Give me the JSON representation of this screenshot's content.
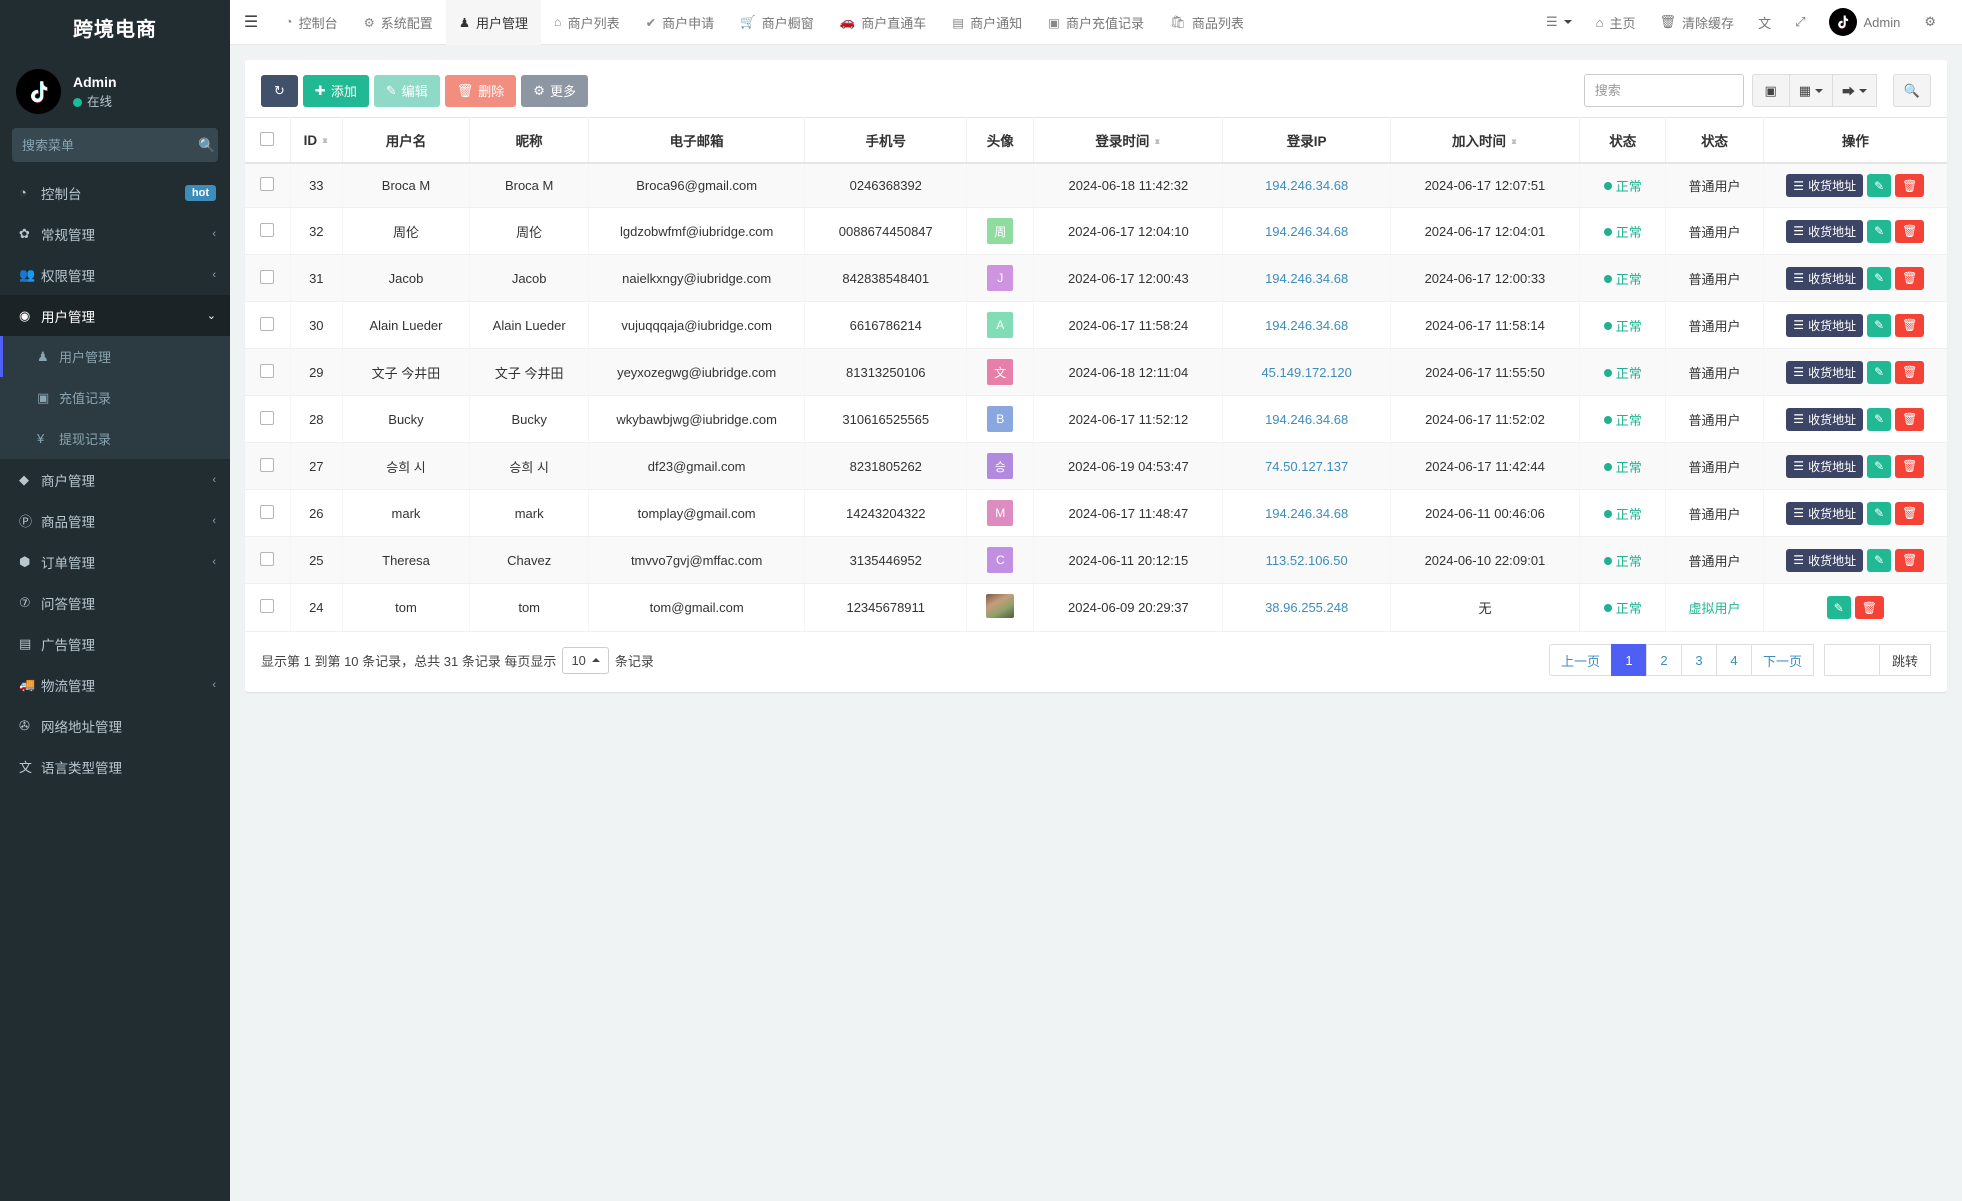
{
  "sidebar": {
    "brand": "跨境电商",
    "user": {
      "name": "Admin",
      "status": "在线"
    },
    "search_placeholder": "搜索菜单",
    "items": [
      {
        "label": "控制台",
        "icon": "dashboard-icon",
        "glyph": "◔",
        "badge": "hot",
        "chevron": ""
      },
      {
        "label": "常规管理",
        "icon": "cogs-icon",
        "glyph": "✿",
        "badge": "",
        "chevron": "‹"
      },
      {
        "label": "权限管理",
        "icon": "users-icon",
        "glyph": "👥",
        "badge": "",
        "chevron": "‹"
      },
      {
        "label": "用户管理",
        "icon": "user-circle-icon",
        "glyph": "◉",
        "badge": "",
        "chevron": "⌄",
        "state": "open"
      },
      {
        "label": "用户管理",
        "icon": "user-icon",
        "glyph": "♟",
        "badge": "",
        "chevron": "",
        "state": "active-sub"
      },
      {
        "label": "充值记录",
        "icon": "money-icon",
        "glyph": "▣",
        "badge": "",
        "chevron": "",
        "state": "sub"
      },
      {
        "label": "提现记录",
        "icon": "yen-icon",
        "glyph": "¥",
        "badge": "",
        "chevron": "",
        "state": "sub"
      },
      {
        "label": "商户管理",
        "icon": "apple-icon",
        "glyph": "",
        "badge": "",
        "chevron": "‹"
      },
      {
        "label": "商品管理",
        "icon": "product-icon",
        "glyph": "Ⓟ",
        "badge": "",
        "chevron": "‹"
      },
      {
        "label": "订单管理",
        "icon": "order-icon",
        "glyph": "⬢",
        "badge": "",
        "chevron": "‹"
      },
      {
        "label": "问答管理",
        "icon": "question-icon",
        "glyph": "⑦",
        "badge": "",
        "chevron": ""
      },
      {
        "label": "广告管理",
        "icon": "ad-icon",
        "glyph": "▤",
        "badge": "",
        "chevron": ""
      },
      {
        "label": "物流管理",
        "icon": "truck-icon",
        "glyph": "🚚",
        "badge": "",
        "chevron": "‹"
      },
      {
        "label": "网络地址管理",
        "icon": "link-icon",
        "glyph": "✇",
        "badge": "",
        "chevron": ""
      },
      {
        "label": "语言类型管理",
        "icon": "language-icon",
        "glyph": "文",
        "badge": "",
        "chevron": ""
      }
    ]
  },
  "topbar": {
    "menu_toggle_icon": "hamburger-icon",
    "nav": [
      {
        "label": "控制台",
        "icon": "dashboard-icon",
        "glyph": "◔",
        "active": false
      },
      {
        "label": "系统配置",
        "icon": "gear-icon",
        "glyph": "⚙",
        "active": false
      },
      {
        "label": "用户管理",
        "icon": "user-icon",
        "glyph": "♟",
        "active": true
      },
      {
        "label": "商户列表",
        "icon": "home-icon",
        "glyph": "⌂",
        "active": false
      },
      {
        "label": "商户申请",
        "icon": "check-circle-icon",
        "glyph": "✔",
        "active": false
      },
      {
        "label": "商户橱窗",
        "icon": "cart-icon",
        "glyph": "🛒",
        "active": false
      },
      {
        "label": "商户直通车",
        "icon": "car-icon",
        "glyph": "🚗",
        "active": false
      },
      {
        "label": "商户通知",
        "icon": "bell-note-icon",
        "glyph": "▤",
        "active": false
      },
      {
        "label": "商户充值记录",
        "icon": "money-icon",
        "glyph": "▣",
        "active": false
      },
      {
        "label": "商品列表",
        "icon": "bag-icon",
        "glyph": "🛍",
        "active": false
      }
    ],
    "right": {
      "list_menu": {
        "label": "",
        "icon": "list-menu-icon",
        "glyph": "☰"
      },
      "home": {
        "label": "主页",
        "icon": "home-icon",
        "glyph": "⌂"
      },
      "clear_cache": {
        "label": "清除缓存",
        "icon": "trash-icon",
        "glyph": "🗑"
      },
      "language": {
        "label": "",
        "icon": "language-icon",
        "glyph": "文"
      },
      "fullscreen": {
        "label": "",
        "icon": "fullscreen-icon",
        "glyph": "⤢"
      },
      "account": {
        "label": "Admin",
        "icon": "tiktok-avatar"
      },
      "settings": {
        "label": "",
        "icon": "gear-icon",
        "glyph": "⚙"
      }
    }
  },
  "toolbar": {
    "refresh_label": "",
    "add_label": "添加",
    "edit_label": "编辑",
    "delete_label": "删除",
    "more_label": "更多",
    "search_placeholder": "搜索",
    "search_value": "",
    "icons": {
      "refresh": "refresh-icon",
      "add": "plus-icon",
      "edit": "pencil-icon",
      "delete": "trash-icon",
      "more": "gear-icon",
      "list_view": "list-view-icon",
      "columns": "columns-grid-icon",
      "export": "export-icon",
      "search": "search-icon"
    }
  },
  "table": {
    "columns": [
      {
        "key": "check",
        "label": "",
        "sortable": false
      },
      {
        "key": "id",
        "label": "ID",
        "sortable": true
      },
      {
        "key": "username",
        "label": "用户名",
        "sortable": false
      },
      {
        "key": "nickname",
        "label": "昵称",
        "sortable": false
      },
      {
        "key": "email",
        "label": "电子邮箱",
        "sortable": false
      },
      {
        "key": "phone",
        "label": "手机号",
        "sortable": false
      },
      {
        "key": "avatar",
        "label": "头像",
        "sortable": false
      },
      {
        "key": "login_time",
        "label": "登录时间",
        "sortable": true
      },
      {
        "key": "login_ip",
        "label": "登录IP",
        "sortable": false
      },
      {
        "key": "join_time",
        "label": "加入时间",
        "sortable": true
      },
      {
        "key": "status",
        "label": "状态",
        "sortable": false
      },
      {
        "key": "user_type",
        "label": "状态",
        "sortable": false
      },
      {
        "key": "actions",
        "label": "操作",
        "sortable": false
      }
    ],
    "rows": [
      {
        "id": "33",
        "username": "Broca M",
        "nickname": "Broca M",
        "email": "Broca96@gmail.com",
        "phone": "0246368392",
        "avatar_letter": "",
        "avatar_color": "",
        "avatar_kind": "none",
        "login_time": "2024-06-18 11:42:32",
        "login_ip": "194.246.34.68",
        "join_time": "2024-06-17 12:07:51",
        "status": "正常",
        "user_type": "普通用户",
        "actions": [
          "收货地址",
          "edit",
          "delete"
        ]
      },
      {
        "id": "32",
        "username": "周伦",
        "nickname": "周伦",
        "email": "lgdzobwfmf@iubridge.com",
        "phone": "0088674450847",
        "avatar_letter": "周",
        "avatar_color": "#8fdba0",
        "avatar_kind": "letter",
        "login_time": "2024-06-17 12:04:10",
        "login_ip": "194.246.34.68",
        "join_time": "2024-06-17 12:04:01",
        "status": "正常",
        "user_type": "普通用户",
        "actions": [
          "收货地址",
          "edit",
          "delete"
        ]
      },
      {
        "id": "31",
        "username": "Jacob",
        "nickname": "Jacob",
        "email": "naielkxngy@iubridge.com",
        "phone": "842838548401",
        "avatar_letter": "J",
        "avatar_color": "#cf94e0",
        "avatar_kind": "letter",
        "login_time": "2024-06-17 12:00:43",
        "login_ip": "194.246.34.68",
        "join_time": "2024-06-17 12:00:33",
        "status": "正常",
        "user_type": "普通用户",
        "actions": [
          "收货地址",
          "edit",
          "delete"
        ]
      },
      {
        "id": "30",
        "username": "Alain Lueder",
        "nickname": "Alain Lueder",
        "email": "vujuqqqaja@iubridge.com",
        "phone": "6616786214",
        "avatar_letter": "A",
        "avatar_color": "#81ddb5",
        "avatar_kind": "letter",
        "login_time": "2024-06-17 11:58:24",
        "login_ip": "194.246.34.68",
        "join_time": "2024-06-17 11:58:14",
        "status": "正常",
        "user_type": "普通用户",
        "actions": [
          "收货地址",
          "edit",
          "delete"
        ]
      },
      {
        "id": "29",
        "username": "文子 今井田",
        "nickname": "文子 今井田",
        "email": "yeyxozegwg@iubridge.com",
        "phone": "81313250106",
        "avatar_letter": "文",
        "avatar_color": "#e87fa8",
        "avatar_kind": "letter",
        "login_time": "2024-06-18 12:11:04",
        "login_ip": "45.149.172.120",
        "join_time": "2024-06-17 11:55:50",
        "status": "正常",
        "user_type": "普通用户",
        "actions": [
          "收货地址",
          "edit",
          "delete"
        ]
      },
      {
        "id": "28",
        "username": "Bucky",
        "nickname": "Bucky",
        "email": "wkybawbjwg@iubridge.com",
        "phone": "310616525565",
        "avatar_letter": "B",
        "avatar_color": "#8aa7e0",
        "avatar_kind": "letter",
        "login_time": "2024-06-17 11:52:12",
        "login_ip": "194.246.34.68",
        "join_time": "2024-06-17 11:52:02",
        "status": "正常",
        "user_type": "普通用户",
        "actions": [
          "收货地址",
          "edit",
          "delete"
        ]
      },
      {
        "id": "27",
        "username": "승희 시",
        "nickname": "승희 시",
        "email": "df23@gmail.com",
        "phone": "8231805262",
        "avatar_letter": "승",
        "avatar_color": "#b18ae0",
        "avatar_kind": "letter",
        "login_time": "2024-06-19 04:53:47",
        "login_ip": "74.50.127.137",
        "join_time": "2024-06-17 11:42:44",
        "status": "正常",
        "user_type": "普通用户",
        "actions": [
          "收货地址",
          "edit",
          "delete"
        ]
      },
      {
        "id": "26",
        "username": "mark",
        "nickname": "mark",
        "email": "tomplay@gmail.com",
        "phone": "14243204322",
        "avatar_letter": "M",
        "avatar_color": "#dd8cc0",
        "avatar_kind": "letter",
        "login_time": "2024-06-17 11:48:47",
        "login_ip": "194.246.34.68",
        "join_time": "2024-06-11 00:46:06",
        "status": "正常",
        "user_type": "普通用户",
        "actions": [
          "收货地址",
          "edit",
          "delete"
        ]
      },
      {
        "id": "25",
        "username": "Theresa",
        "nickname": "Chavez",
        "email": "tmvvo7gvj@mffac.com",
        "phone": "3135446952",
        "avatar_letter": "C",
        "avatar_color": "#c190e3",
        "avatar_kind": "letter",
        "login_time": "2024-06-11 20:12:15",
        "login_ip": "113.52.106.50",
        "join_time": "2024-06-10 22:09:01",
        "status": "正常",
        "user_type": "普通用户",
        "actions": [
          "收货地址",
          "edit",
          "delete"
        ]
      },
      {
        "id": "24",
        "username": "tom",
        "nickname": "tom",
        "email": "tom@gmail.com",
        "phone": "12345678911",
        "avatar_letter": "",
        "avatar_color": "",
        "avatar_kind": "photo",
        "login_time": "2024-06-09 20:29:37",
        "login_ip": "38.96.255.248",
        "join_time": "无",
        "status": "正常",
        "user_type": "虚拟用户",
        "actions": [
          "edit",
          "delete"
        ]
      }
    ]
  },
  "footer": {
    "summary_prefix": "显示第 1 到第 10 条记录，总共 31 条记录 每页显示",
    "page_size": "10",
    "summary_suffix": "条记录",
    "prev_label": "上一页",
    "pages": [
      "1",
      "2",
      "3",
      "4"
    ],
    "current_page": "1",
    "next_label": "下一页",
    "jump_value": "",
    "jump_label": "跳转"
  },
  "colors": {
    "accent_blue": "#4f5ff5",
    "teal": "#21b894",
    "danger": "#f44336",
    "navy": "#3d4566",
    "sidebar_bg": "#222d32",
    "link": "#3c8dbc"
  }
}
